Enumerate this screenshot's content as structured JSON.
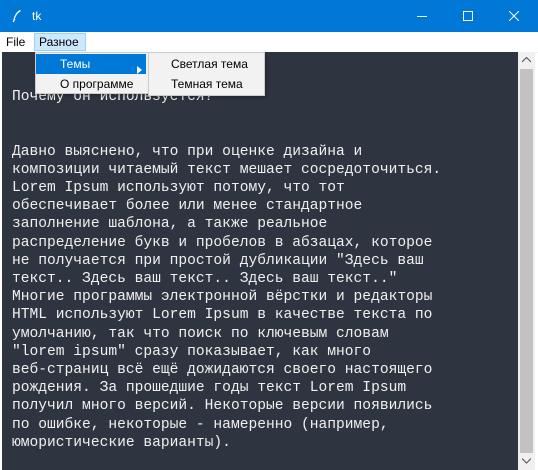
{
  "window": {
    "title": "tk",
    "title_bar_color": "#0078d7"
  },
  "menubar": {
    "file_label": "File",
    "raznoe_label": "Разное"
  },
  "dropdown": {
    "items": [
      {
        "label": "Темы",
        "has_submenu": true,
        "active": true
      },
      {
        "label": "О программе",
        "has_submenu": false,
        "active": false
      }
    ]
  },
  "submenu": {
    "items": [
      {
        "label": "Светлая тема"
      },
      {
        "label": "Темная тема"
      }
    ]
  },
  "editor": {
    "background": "#2f3540",
    "text_color": "#f0f0f0",
    "lines": [
      "Почему он используется?",
      "",
      "",
      "Давно выяснено, что при оценке дизайна и",
      "композиции читаемый текст мешает сосредоточиться.",
      "Lorem Ipsum используют потому, что тот",
      "обеспечивает более или менее стандартное",
      "заполнение шаблона, а также реальное",
      "распределение букв и пробелов в абзацах, которое",
      "не получается при простой дубликации \"Здесь ваш",
      "текст.. Здесь ваш текст.. Здесь ваш текст..\"",
      "Многие программы электронной вёрстки и редакторы",
      "HTML используют Lorem Ipsum в качестве текста по",
      "умолчанию, так что поиск по ключевым словам",
      "\"lorem ipsum\" сразу показывает, как много",
      "веб-страниц всё ещё дожидаются своего настоящего",
      "рождения. За прошедшие годы текст Lorem Ipsum",
      "получил много версий. Некоторые версии появились",
      "по ошибке, некоторые - намеренно (например,",
      "юмористические варианты)."
    ]
  }
}
